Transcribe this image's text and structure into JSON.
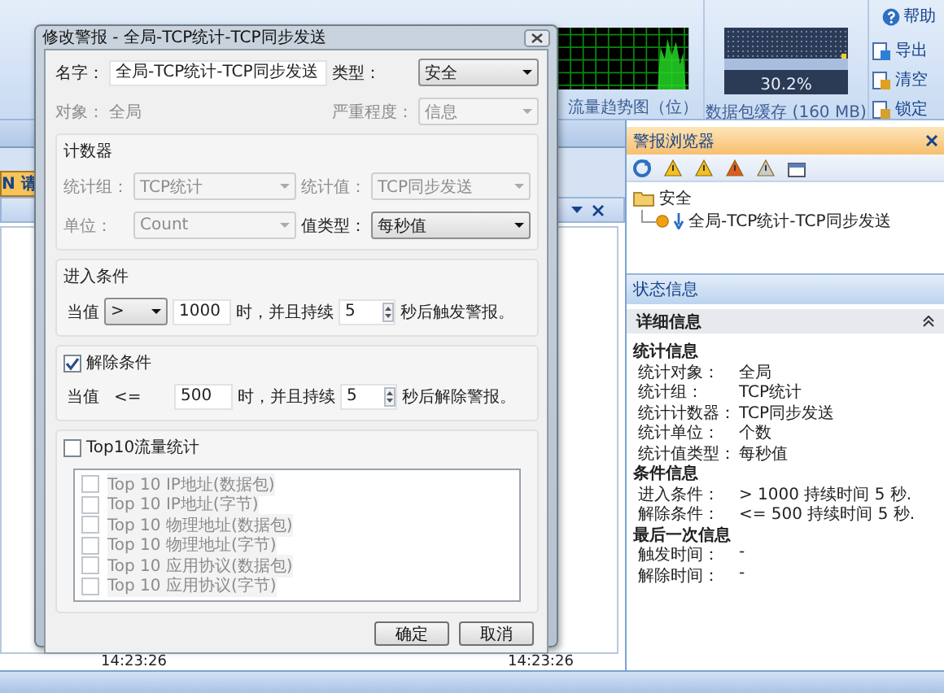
{
  "ribbon": {
    "help": "帮助",
    "traffic_caption": "流量趋势图（位）",
    "buffer_reading": "30.2%",
    "buffer_caption": "数据包缓存 (160 MB)",
    "buffer_buttons": [
      "导出",
      "清空",
      "锁定"
    ]
  },
  "left_panel": {
    "tab_fragment": "N 请",
    "times": [
      "14:23:26",
      "14:23:26"
    ]
  },
  "alert_browser": {
    "title": "警报浏览器",
    "tree": [
      {
        "label": "安全",
        "expanded": true,
        "children": [
          {
            "label": "全局-TCP统计-TCP同步发送"
          }
        ]
      }
    ]
  },
  "status_info": {
    "title": "状态信息",
    "section": "详细信息",
    "expanded": true,
    "groups": [
      {
        "title": "统计信息",
        "rows": [
          {
            "label": "统计对象：",
            "value": "全局"
          },
          {
            "label": "统计组：",
            "value": "TCP统计"
          },
          {
            "label": "统计计数器：",
            "value": "TCP同步发送"
          },
          {
            "label": "统计单位：",
            "value": "个数"
          },
          {
            "label": "统计值类型：",
            "value": "每秒值"
          }
        ]
      },
      {
        "title": "条件信息",
        "rows": [
          {
            "label": "进入条件：",
            "value": "> 1000 持续时间 5 秒."
          },
          {
            "label": "解除条件：",
            "value": "<= 500 持续时间 5 秒."
          }
        ]
      },
      {
        "title": "最后一次信息",
        "rows": [
          {
            "label": "触发时间：",
            "value": "-"
          },
          {
            "label": "解除时间：",
            "value": "-"
          }
        ]
      }
    ]
  },
  "dialog": {
    "title": "修改警报 - 全局-TCP统计-TCP同步发送",
    "top_fields": [
      {
        "label": "名字：",
        "value": "全局-TCP统计-TCP同步发送",
        "kind": "input",
        "disabled": false
      },
      {
        "label": "类型：",
        "value": "安全",
        "kind": "select",
        "disabled": false
      },
      {
        "label": "对象：",
        "value": "全局",
        "kind": "text",
        "disabled": true
      },
      {
        "label": "严重程度：",
        "value": "信息",
        "kind": "select",
        "disabled": true
      }
    ],
    "counter": {
      "title": "计数器",
      "fields": [
        {
          "label": "统计组：",
          "value": "TCP统计",
          "kind": "select",
          "disabled": true
        },
        {
          "label": "统计值：",
          "value": "TCP同步发送",
          "kind": "select",
          "disabled": true
        },
        {
          "label": "单位：",
          "value": "Count",
          "kind": "select",
          "disabled": true
        },
        {
          "label": "值类型：",
          "value": "每秒值",
          "kind": "select",
          "disabled": false
        }
      ]
    },
    "enter": {
      "title": "进入条件",
      "when": "当值",
      "operator": {
        "kind": "select",
        "text": ">"
      },
      "value": "1000",
      "mid": "时，并且持续",
      "duration": "5",
      "tail": "秒后触发警报。"
    },
    "release": {
      "title": "解除条件",
      "checked": true,
      "when": "当值",
      "operator": {
        "kind": "text",
        "text": "<="
      },
      "value": "500",
      "mid": "时，并且持续",
      "duration": "5",
      "tail": "秒后解除警报。"
    },
    "top10": {
      "title": "Top10流量统计",
      "checked": false,
      "items": [
        {
          "label": "Top 10 IP地址(数据包)",
          "checked": false,
          "disabled": true
        },
        {
          "label": "Top 10 IP地址(字节)",
          "checked": false,
          "disabled": true
        },
        {
          "label": "Top 10 物理地址(数据包)",
          "checked": false,
          "disabled": true
        },
        {
          "label": "Top 10 物理地址(字节)",
          "checked": false,
          "disabled": true
        },
        {
          "label": "Top 10 应用协议(数据包)",
          "checked": false,
          "disabled": true
        },
        {
          "label": "Top 10 应用协议(字节)",
          "checked": false,
          "disabled": true
        }
      ]
    },
    "buttons": [
      "确定",
      "取消"
    ]
  }
}
